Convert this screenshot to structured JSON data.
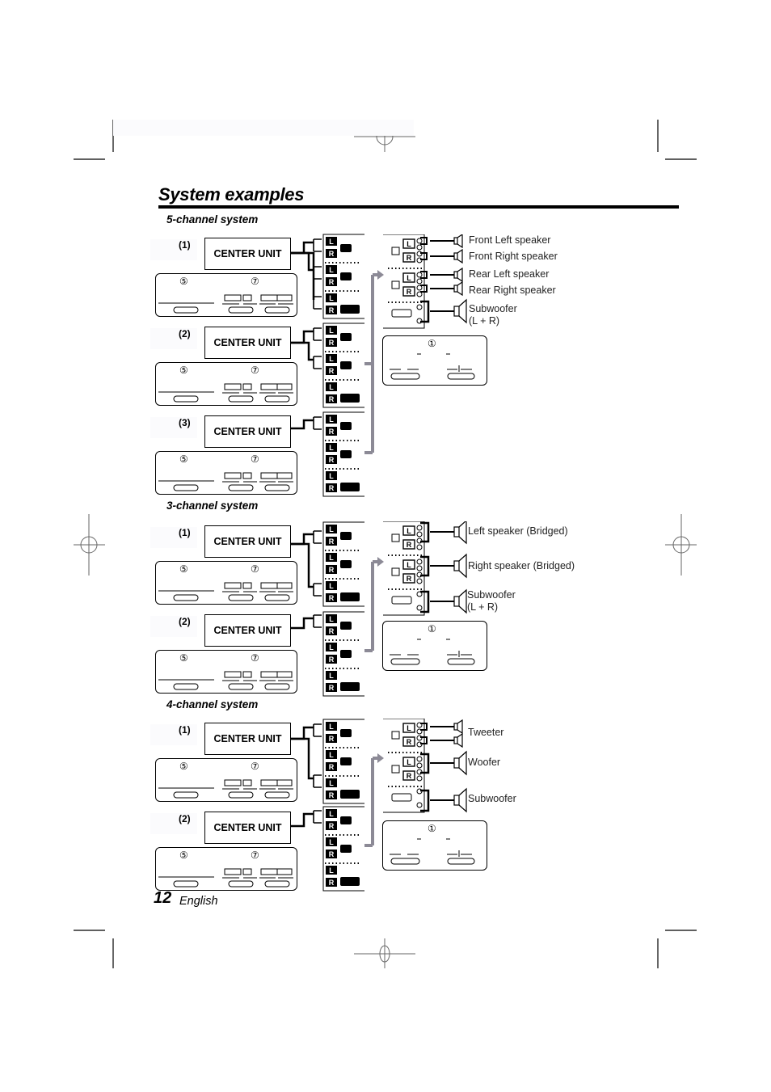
{
  "page": {
    "title": "System examples",
    "page_number": "12",
    "language": "English"
  },
  "sections": [
    {
      "heading": "5-channel system",
      "configs": [
        {
          "label": "(1)",
          "unit": "CENTER UNIT",
          "knob_a": "⑤",
          "knob_b": "⑦"
        },
        {
          "label": "(2)",
          "unit": "CENTER UNIT",
          "knob_a": "⑤",
          "knob_b": "⑦"
        },
        {
          "label": "(3)",
          "unit": "CENTER UNIT",
          "knob_a": "⑤",
          "knob_b": "⑦"
        }
      ],
      "amp_knob": "①",
      "speakers": [
        "Front Left speaker",
        "Front Right speaker",
        "Rear Left speaker",
        "Rear Right speaker",
        "Subwoofer",
        "(L + R)"
      ]
    },
    {
      "heading": "3-channel system",
      "configs": [
        {
          "label": "(1)",
          "unit": "CENTER UNIT",
          "knob_a": "⑤",
          "knob_b": "⑦"
        },
        {
          "label": "(2)",
          "unit": "CENTER UNIT",
          "knob_a": "⑤",
          "knob_b": "⑦"
        }
      ],
      "amp_knob": "①",
      "speakers": [
        "Left speaker (Bridged)",
        "Right speaker (Bridged)",
        "Subwoofer",
        "(L + R)"
      ]
    },
    {
      "heading": "4-channel system",
      "configs": [
        {
          "label": "(1)",
          "unit": "CENTER UNIT",
          "knob_a": "⑤",
          "knob_b": "⑦"
        },
        {
          "label": "(2)",
          "unit": "CENTER UNIT",
          "knob_a": "⑤",
          "knob_b": "⑦"
        }
      ],
      "amp_knob": "①",
      "speakers": [
        "Tweeter",
        "Woofer",
        "Subwoofer"
      ]
    }
  ],
  "terminal_labels": {
    "left": "L",
    "right": "R"
  }
}
